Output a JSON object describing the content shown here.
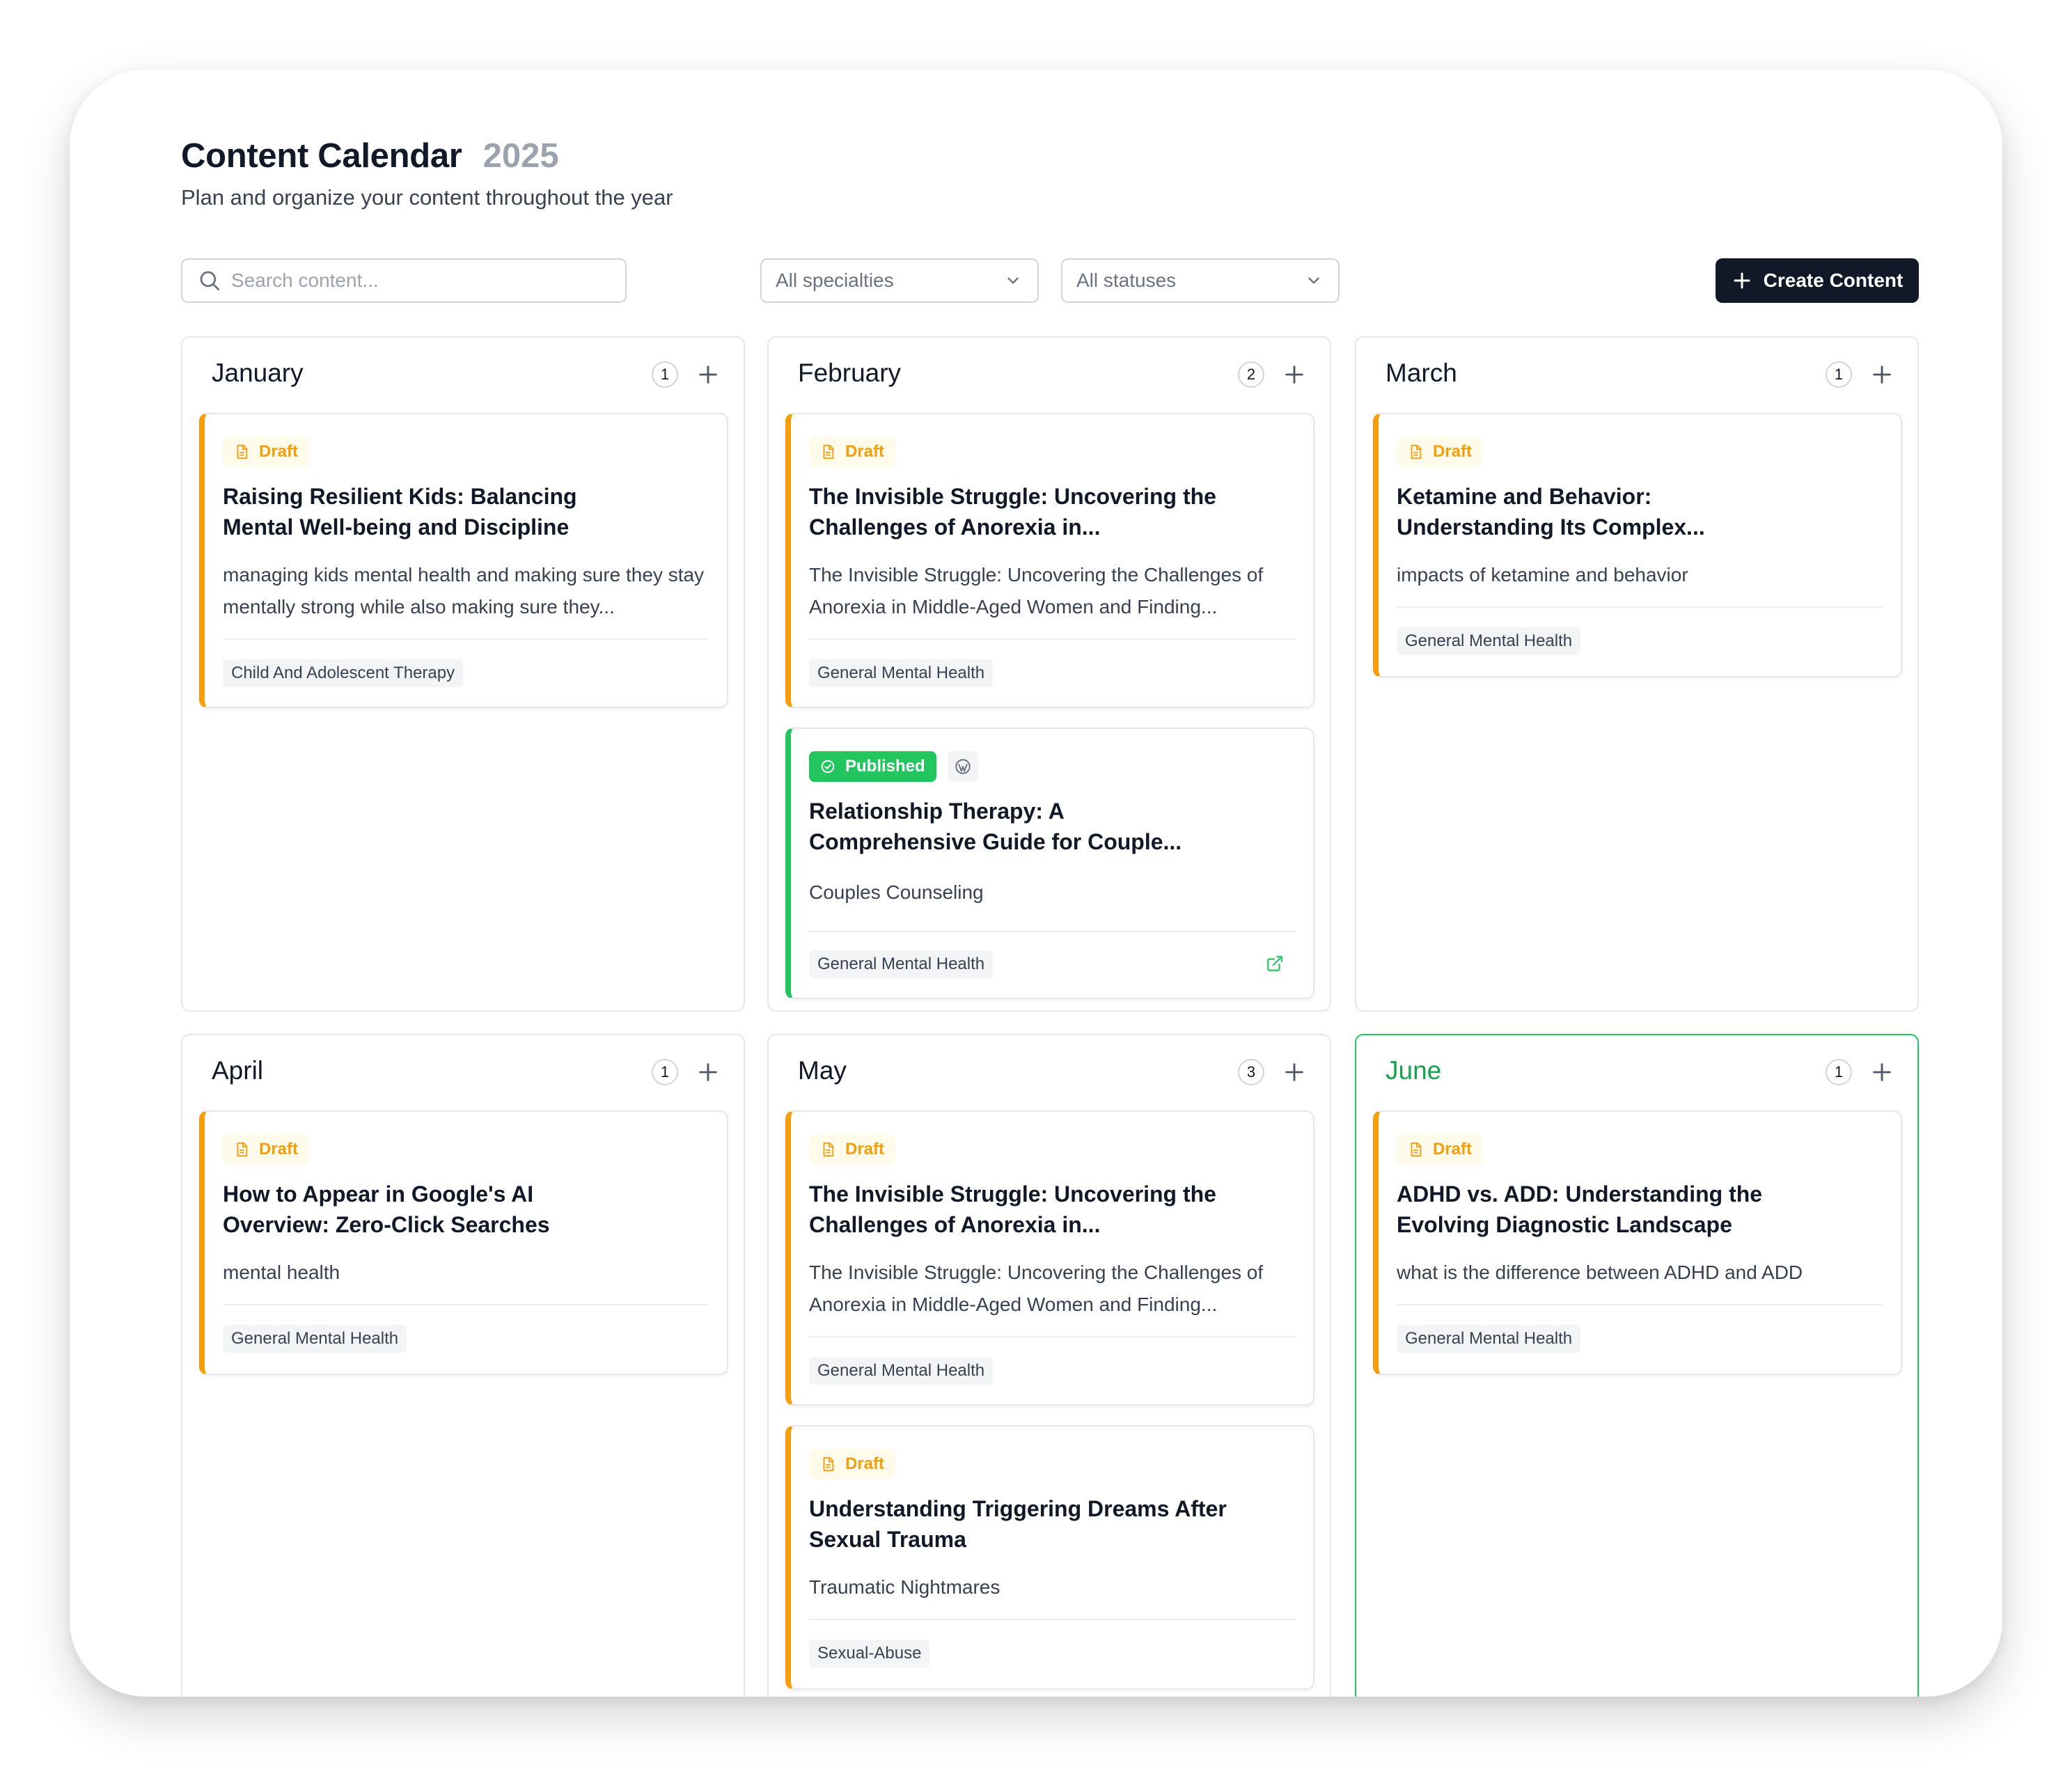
{
  "header": {
    "title": "Content Calendar",
    "year": "2025",
    "subtitle": "Plan and organize your content throughout the year"
  },
  "toolbar": {
    "search_placeholder": "Search content...",
    "specialty_filter": "All specialties",
    "status_filter": "All statuses",
    "create_label": "Create Content"
  },
  "icons": {
    "search": "search-icon",
    "chevron": "chevron-down-icon",
    "plus": "plus-icon",
    "draft": "document-icon",
    "published": "check-circle-icon",
    "wordpress": "wordpress-icon",
    "external": "external-link-icon"
  },
  "colors": {
    "draft": "#f59e0b",
    "published": "#22c55e",
    "current_month": "#22c55e",
    "primary_button": "#111827"
  },
  "months": [
    {
      "name": "January",
      "count": "1",
      "cards": [
        {
          "status": "Draft",
          "title": "Raising Resilient Kids: Balancing Mental Well-being and Discipline",
          "description": "managing kids mental health and making sure they stay mentally strong while also making sure they...",
          "tag": "Child And Adolescent Therapy"
        }
      ]
    },
    {
      "name": "February",
      "count": "2",
      "cards": [
        {
          "status": "Draft",
          "title": "The Invisible Struggle: Uncovering the Challenges of Anorexia in...",
          "description": "The Invisible Struggle: Uncovering the Challenges of Anorexia in Middle-Aged Women and Finding...",
          "tag": "General Mental Health"
        },
        {
          "status": "Published",
          "title": "Relationship Therapy: A Comprehensive Guide for Couple...",
          "description": "Couples Counseling",
          "tag": "General Mental Health"
        }
      ]
    },
    {
      "name": "March",
      "count": "1",
      "cards": [
        {
          "status": "Draft",
          "title": "Ketamine and Behavior: Understanding Its Complex...",
          "description": "impacts of ketamine and behavior",
          "tag": "General Mental Health"
        }
      ]
    },
    {
      "name": "April",
      "count": "1",
      "cards": [
        {
          "status": "Draft",
          "title": "How to Appear in Google's AI Overview: Zero-Click Searches",
          "description": "mental health",
          "tag": "General Mental Health"
        }
      ]
    },
    {
      "name": "May",
      "count": "3",
      "cards": [
        {
          "status": "Draft",
          "title": "The Invisible Struggle: Uncovering the Challenges of Anorexia in...",
          "description": "The Invisible Struggle: Uncovering the Challenges of Anorexia in Middle-Aged Women and Finding...",
          "tag": "General Mental Health"
        },
        {
          "status": "Draft",
          "title": "Understanding Triggering Dreams After Sexual Trauma",
          "description": "Traumatic Nightmares",
          "tag": "Sexual-Abuse"
        }
      ]
    },
    {
      "name": "June",
      "count": "1",
      "cards": [
        {
          "status": "Draft",
          "title": "ADHD vs. ADD: Understanding the Evolving Diagnostic Landscape",
          "description": "what is the difference between ADHD and ADD",
          "tag": "General Mental Health"
        }
      ]
    }
  ]
}
